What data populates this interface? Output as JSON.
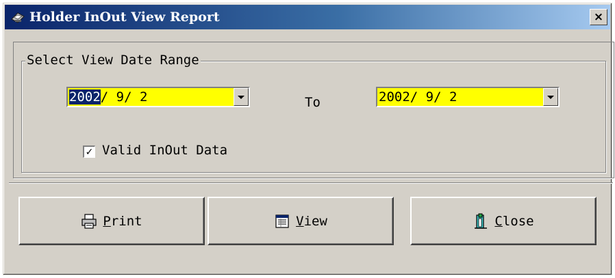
{
  "window": {
    "title": "Holder InOut View Report",
    "close_glyph": "×"
  },
  "date_range": {
    "legend": "Select View Date Range",
    "from": {
      "selected_part": "2002",
      "rest": "/ 9/ 2"
    },
    "to_label": "To",
    "to": {
      "value": "2002/ 9/ 2"
    },
    "field_bg": "#ffff00"
  },
  "valid_data": {
    "label": "Valid InOut Data",
    "checked": true,
    "check_glyph": "✓"
  },
  "buttons": {
    "print": {
      "mnemonic": "P",
      "rest": "rint",
      "icon": "printer-icon"
    },
    "view": {
      "mnemonic": "V",
      "rest": "iew",
      "icon": "report-view-icon"
    },
    "close": {
      "mnemonic": "C",
      "rest": "lose",
      "icon": "exit-door-icon"
    }
  },
  "colors": {
    "titlebar_start": "#0a246a",
    "titlebar_end": "#a6caf0",
    "face": "#d4d0c8",
    "selection": "#0a246a"
  }
}
